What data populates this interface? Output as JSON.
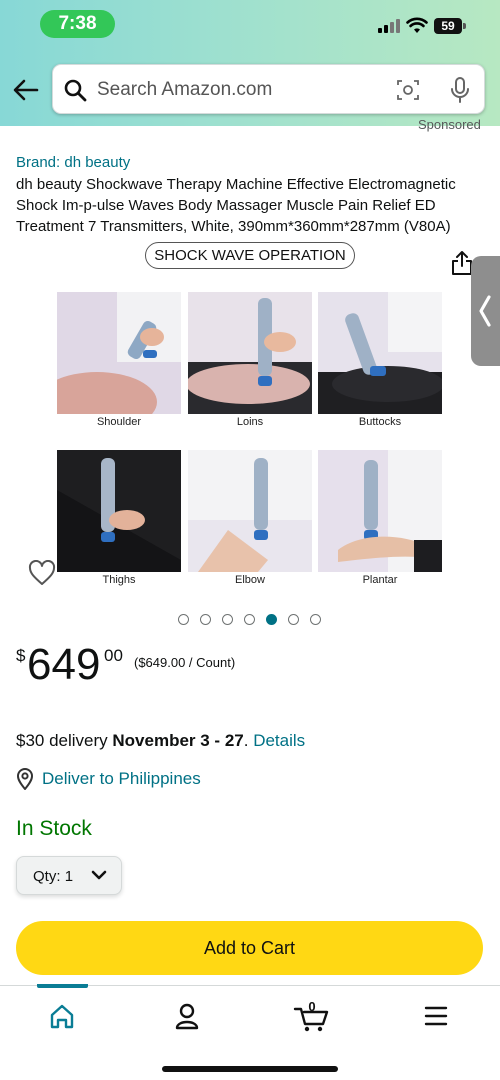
{
  "status_bar": {
    "time": "7:38",
    "battery": "59"
  },
  "search": {
    "placeholder": "Search Amazon.com"
  },
  "sponsored_label": "Sponsored",
  "product": {
    "brand": "Brand: dh beauty",
    "title": "dh beauty Shockwave Therapy Machine Effective Electromagnetic Shock Im-p-ulse Waves Body Massager Muscle Pain Relief ED Treatment 7 Transmitters, White, 390mm*360mm*287mm (V80A)",
    "image_banner": "SHOCK WAVE OPERATION",
    "image_captions": [
      "Shoulder",
      "Loins",
      "Buttocks",
      "Thighs",
      "Elbow",
      "Plantar"
    ],
    "carousel": {
      "count": 7,
      "active_index": 4
    }
  },
  "price": {
    "currency": "$",
    "whole": "649",
    "fraction": "00",
    "per_unit": "($649.00 / Count)"
  },
  "delivery": {
    "prefix": "$30 delivery ",
    "dates": "November 3 - 27",
    "suffix": ". ",
    "details_link": "Details"
  },
  "deliver_to": "Deliver to Philippines",
  "stock": "In Stock",
  "quantity": {
    "label": "Qty:",
    "value": "1"
  },
  "add_to_cart": "Add to Cart",
  "bottom_nav": {
    "cart_count": "0",
    "active": "home"
  },
  "colors": {
    "link": "#007185",
    "in_stock": "#007600",
    "add_to_cart": "#ffd814",
    "accent": "#0a7d95"
  }
}
